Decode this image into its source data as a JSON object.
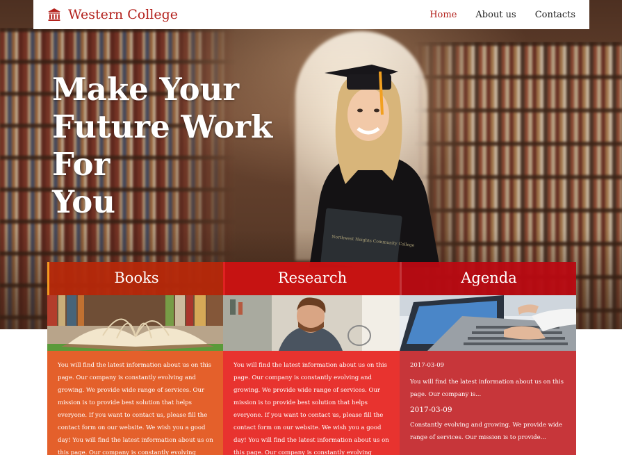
{
  "brand": {
    "name": "Western College",
    "icon": "columns-building-icon",
    "color": "#b3211c"
  },
  "nav": {
    "items": [
      {
        "label": "Home",
        "active": true
      },
      {
        "label": "About us",
        "active": false
      },
      {
        "label": "Contacts",
        "active": false
      }
    ]
  },
  "hero": {
    "headline": "Make Your\nFuture Work For\nYou",
    "book_cover_text": "Northwest Heights Community College"
  },
  "cards": [
    {
      "title": "Books",
      "body": "You will find the latest information about us on this page. Our company is constantly evolving and growing. We provide wide range of services. Our mission is to provide best solution that helps everyone. If you want to contact us, please fill the contact form on our website. We wish you a good day! You will find the latest information about us on this page. Our company is constantly evolving and..."
    },
    {
      "title": "Research",
      "body": "You will find the latest information about us on this page. Our company is constantly evolving and growing. We provide wide range of services. Our mission is to provide best solution that helps everyone. If you want to contact us, please fill the contact form on our website. We wish you a good day! You will find the latest information about us on this page. Our company is constantly evolving and..."
    },
    {
      "title": "Agenda",
      "entries": [
        {
          "date": "2017-03-09",
          "text": "You will find the latest information about us on this page. Our company is..."
        },
        {
          "date": "2017-03-09",
          "text": "Constantly evolving and growing. We provide wide range of services. Our mission is to provide..."
        }
      ]
    }
  ],
  "colors": {
    "books_body": "#e4602b",
    "research_body": "#e8332f",
    "agenda_body": "#c7363a"
  }
}
